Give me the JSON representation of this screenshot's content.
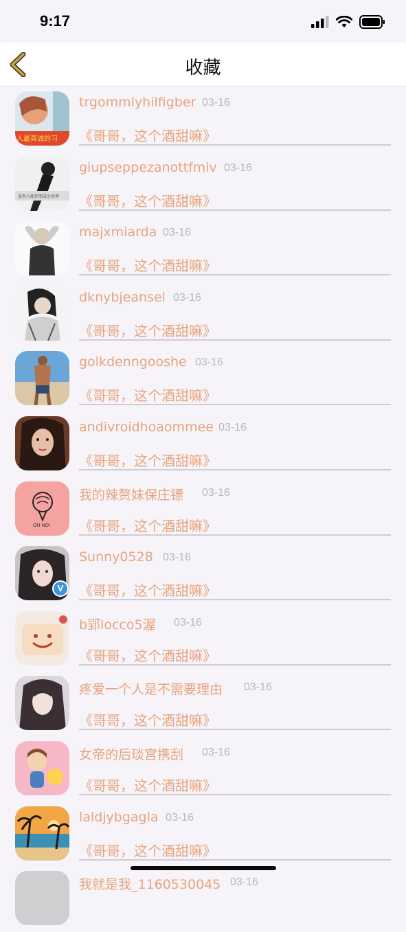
{
  "status": {
    "time": "9:17"
  },
  "nav": {
    "title": "收藏",
    "back_icon": "chevron-left-icon"
  },
  "colors": {
    "accent": "#e8a37c",
    "date": "#b9b6bd",
    "back": "#d4a92a"
  },
  "items": [
    {
      "name": "trgommlyhilfigber",
      "date": "03-16",
      "quote": "《哥哥，这个酒甜嘛》",
      "avatar_text": "人最真诚的习"
    },
    {
      "name": "giupseppezanottfmiv",
      "date": "03-16",
      "quote": "《哥哥，这个酒甜嘛》",
      "avatar_text": "没有人能你而成全世界"
    },
    {
      "name": "majxmiarda",
      "date": "03-16",
      "quote": "《哥哥，这个酒甜嘛》"
    },
    {
      "name": "dknybjeansel",
      "date": "03-16",
      "quote": "《哥哥，这个酒甜嘛》"
    },
    {
      "name": "golkdenngooshe",
      "date": "03-16",
      "quote": "《哥哥，这个酒甜嘛》"
    },
    {
      "name": "andivroidhoaommee",
      "date": "03-16",
      "quote": "《哥哥，这个酒甜嘛》"
    },
    {
      "name": "我的辣赘妹保庄镖",
      "date": "03-16",
      "quote": "《哥哥，这个酒甜嘛》",
      "avatar_text": "OH NO!"
    },
    {
      "name": "Sunny0528",
      "date": "03-16",
      "quote": "《哥哥，这个酒甜嘛》",
      "verified": "V"
    },
    {
      "name": "b郢locco5渥",
      "date": "03-16",
      "quote": "《哥哥，这个酒甜嘛》"
    },
    {
      "name": "疼爱一个人是不需要理由",
      "date": "03-16",
      "quote": "《哥哥，这个酒甜嘛》"
    },
    {
      "name": "女帝的后琰宫携刮",
      "date": "03-16",
      "quote": "《哥哥，这个酒甜嘛》"
    },
    {
      "name": "laldjybgagla",
      "date": "03-16",
      "quote": "《哥哥，这个酒甜嘛》"
    },
    {
      "name": "我就是我_1160530045",
      "date": "03-16",
      "quote": ""
    }
  ]
}
